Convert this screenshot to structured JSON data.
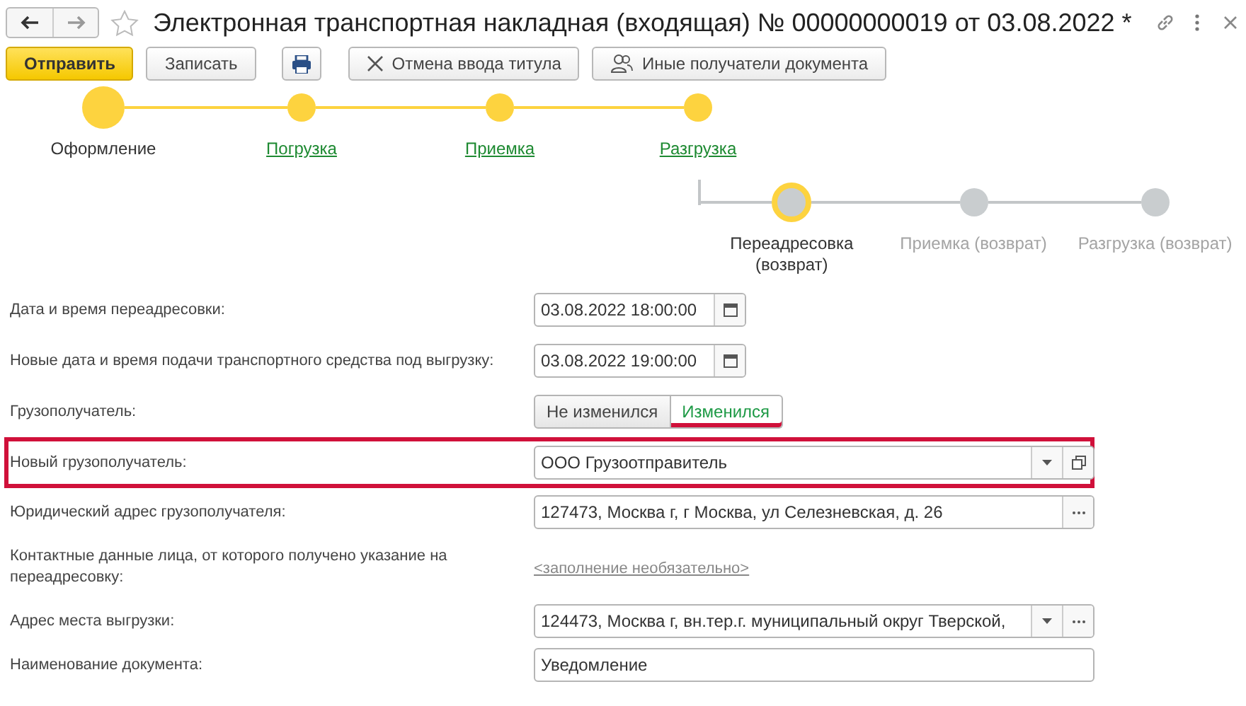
{
  "window": {
    "title": "Электронная транспортная накладная (входящая) № 00000000019 от 03.08.2022 *"
  },
  "toolbar": [
    {
      "label": "Отправить",
      "kind": "primary"
    },
    {
      "label": "Записать",
      "kind": "plain"
    },
    {
      "kind": "print"
    },
    {
      "label": "Отмена ввода титула",
      "kind": "cancel"
    },
    {
      "label": "Иные получатели документа",
      "kind": "people"
    }
  ],
  "stepper": {
    "steps": [
      {
        "label": "Оформление",
        "selected": true
      },
      {
        "label": "Погрузка",
        "selected": false
      },
      {
        "label": "Приемка",
        "selected": false
      },
      {
        "label": "Разгрузка",
        "selected": false
      }
    ]
  },
  "return_stepper": {
    "steps": [
      {
        "label": "Переадресовка (возврат)",
        "selected": true
      },
      {
        "label": "Приемка (возврат)",
        "selected": false
      },
      {
        "label": "Разгрузка (возврат)",
        "selected": false
      }
    ]
  },
  "form": [
    {
      "label": "Дата и время переадресовки:",
      "kind": "date",
      "value": "03.08.2022 18:00:00",
      "highlighted": false
    },
    {
      "label": "Новые дата и время подачи транспортного средства под выгрузку:",
      "kind": "date",
      "value": "03.08.2022 19:00:00",
      "highlighted": false
    },
    {
      "label": "Грузополучатель:",
      "kind": "toggle",
      "highlighted": false,
      "options": [
        {
          "label": "Не изменился",
          "selected": false
        },
        {
          "label": "Изменился",
          "selected": true
        }
      ]
    },
    {
      "label": "Новый грузополучатель:",
      "kind": "select",
      "value": "ООО Грузоотправитель",
      "highlighted": true
    },
    {
      "label": "Юридический адрес грузополучателя:",
      "kind": "choice",
      "value": "127473, Москва г, г Москва, ул Селезневская, д. 26",
      "highlighted": false
    },
    {
      "label": "Контактные данные лица, от которого получено указание на переадресовку:",
      "kind": "link",
      "value": "<заполнение необязательно>",
      "highlighted": false
    },
    {
      "label": "Адрес места выгрузки:",
      "kind": "select_choice",
      "value": "124473, Москва г, вн.тер.г. муниципальный округ Тверской,",
      "highlighted": false
    },
    {
      "label": "Наименование документа:",
      "kind": "text",
      "value": "Уведомление",
      "highlighted": false
    }
  ]
}
